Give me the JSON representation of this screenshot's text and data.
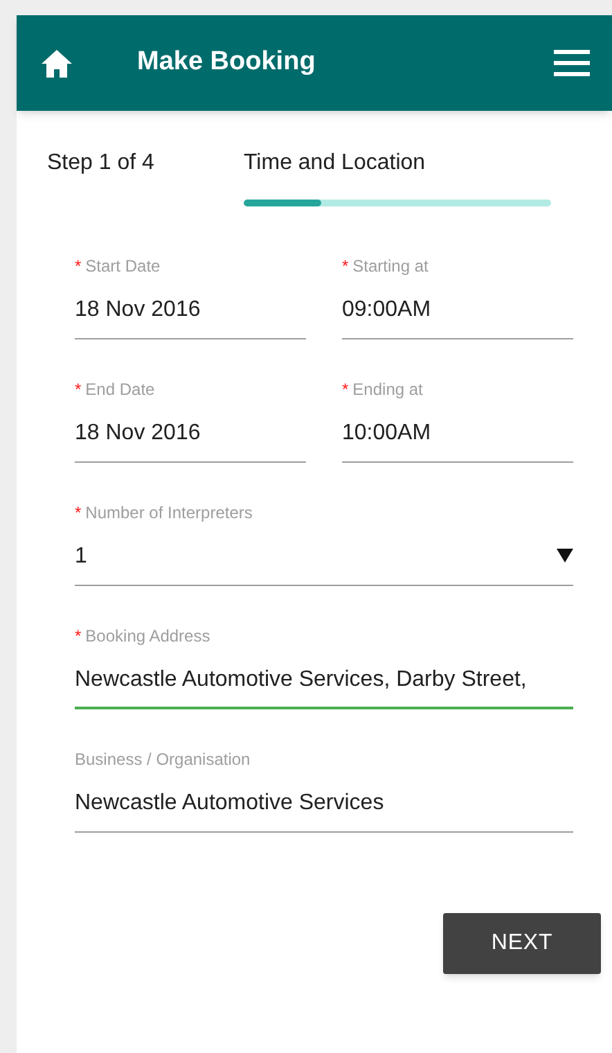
{
  "header": {
    "title": "Make Booking"
  },
  "step": {
    "label": "Step 1 of 4",
    "title": "Time and Location",
    "level": 0.25
  },
  "rows": [
    {
      "fields": [
        {
          "kind": "text",
          "marker": "*",
          "label": "Start Date",
          "value": "18 Nov 2016",
          "focused": false
        },
        {
          "kind": "text",
          "marker": "*",
          "label": "Starting at",
          "value": "09:00AM",
          "focused": false
        }
      ]
    },
    {
      "fields": [
        {
          "kind": "text",
          "marker": "*",
          "label": "End Date",
          "value": "18 Nov 2016",
          "focused": false
        },
        {
          "kind": "text",
          "marker": "*",
          "label": "Ending at",
          "value": "10:00AM",
          "focused": false
        }
      ]
    },
    {
      "fields": [
        {
          "kind": "select",
          "marker": "*",
          "label": "Number of Interpreters",
          "value": "1",
          "focused": false
        }
      ]
    },
    {
      "fields": [
        {
          "kind": "text",
          "marker": "*",
          "label": "Booking Address",
          "value": "Newcastle Automotive Services, Darby Street,",
          "focused": true
        }
      ]
    },
    {
      "fields": [
        {
          "kind": "text",
          "label": "Business / Organisation",
          "value": "Newcastle Automotive Services",
          "focused": false
        }
      ]
    }
  ],
  "button": {
    "label": "NEXT"
  }
}
